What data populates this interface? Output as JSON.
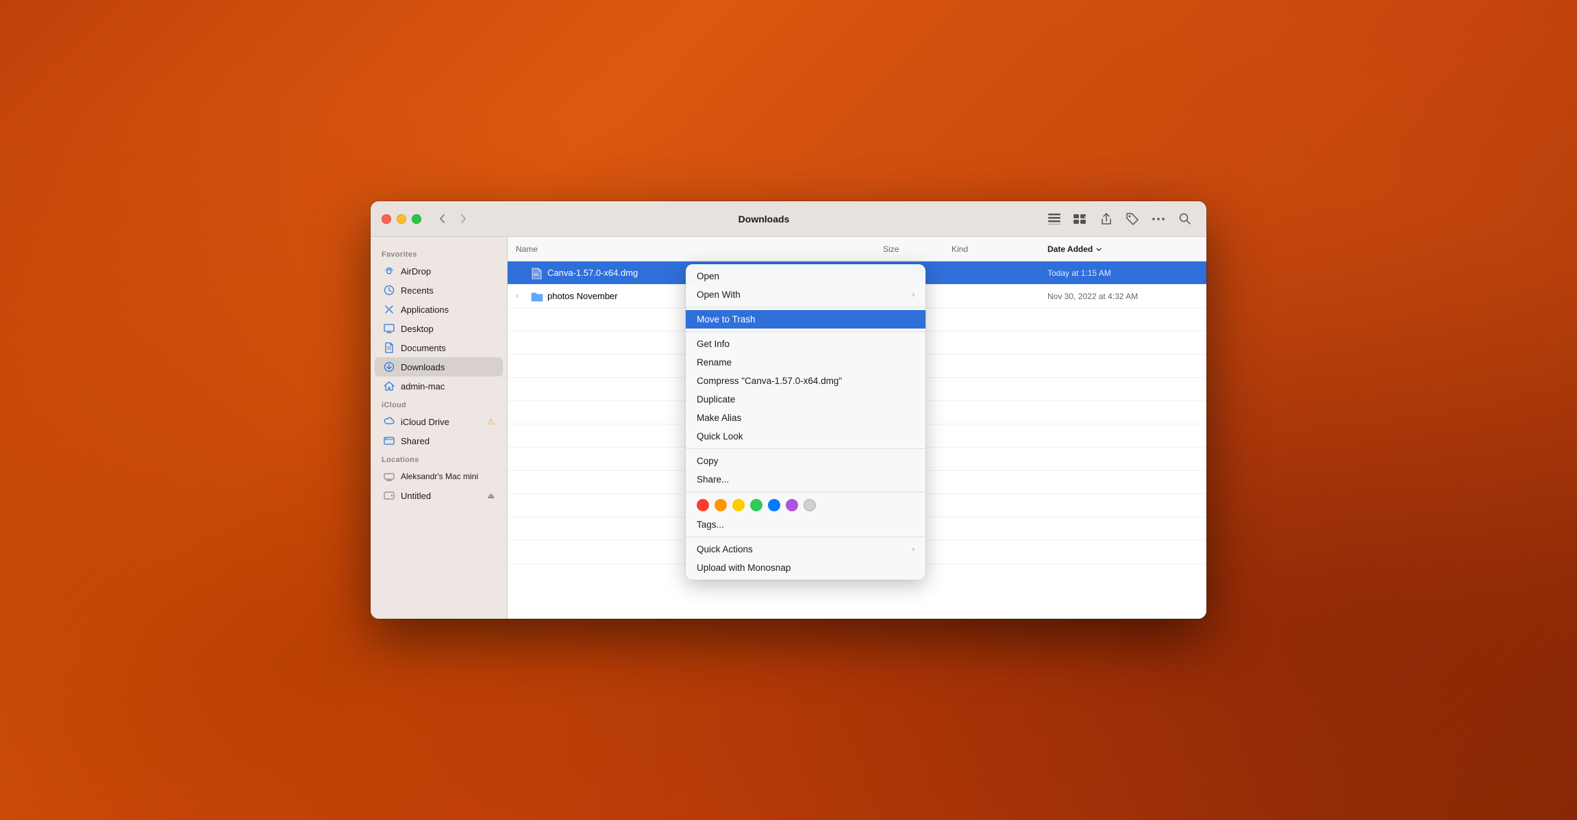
{
  "window": {
    "title": "Downloads"
  },
  "sidebar": {
    "sections": [
      {
        "label": "Favorites",
        "items": [
          {
            "id": "airdrop",
            "label": "AirDrop",
            "icon": "airdrop"
          },
          {
            "id": "recents",
            "label": "Recents",
            "icon": "recents"
          },
          {
            "id": "applications",
            "label": "Applications",
            "icon": "applications"
          },
          {
            "id": "desktop",
            "label": "Desktop",
            "icon": "desktop"
          },
          {
            "id": "documents",
            "label": "Documents",
            "icon": "documents"
          },
          {
            "id": "downloads",
            "label": "Downloads",
            "icon": "downloads",
            "active": true
          },
          {
            "id": "admin-mac",
            "label": "admin-mac",
            "icon": "home"
          }
        ]
      },
      {
        "label": "iCloud",
        "items": [
          {
            "id": "icloud-drive",
            "label": "iCloud Drive",
            "icon": "icloud",
            "warning": true
          },
          {
            "id": "shared",
            "label": "Shared",
            "icon": "shared"
          }
        ]
      },
      {
        "label": "Locations",
        "items": [
          {
            "id": "mac-mini",
            "label": "Aleksandr's Mac mini",
            "icon": "computer"
          },
          {
            "id": "untitled",
            "label": "Untitled",
            "icon": "drive",
            "eject": true
          }
        ]
      }
    ]
  },
  "columns": {
    "name": "Name",
    "size": "Size",
    "kind": "Kind",
    "date": "Date Added"
  },
  "files": [
    {
      "id": 1,
      "name": "Canva-1.57.0-x64.dmg",
      "size": "",
      "kind": "",
      "date": "Today at 1:15 AM",
      "selected": true,
      "type": "dmg",
      "expand": false
    },
    {
      "id": 2,
      "name": "photos November",
      "size": "",
      "kind": "",
      "date": "Nov 30, 2022 at 4:32 AM",
      "selected": false,
      "type": "folder",
      "expand": true
    }
  ],
  "context_menu": {
    "items": [
      {
        "id": "open",
        "label": "Open",
        "has_arrow": false,
        "separator_after": false
      },
      {
        "id": "open-with",
        "label": "Open With",
        "has_arrow": true,
        "separator_after": true
      },
      {
        "id": "move-to-trash",
        "label": "Move to Trash",
        "highlighted": true,
        "has_arrow": false,
        "separator_after": false
      },
      {
        "id": "get-info",
        "label": "Get Info",
        "has_arrow": false,
        "separator_after": false
      },
      {
        "id": "rename",
        "label": "Rename",
        "has_arrow": false,
        "separator_after": false
      },
      {
        "id": "compress",
        "label": "Compress \"Canva-1.57.0-x64.dmg\"",
        "has_arrow": false,
        "separator_after": false
      },
      {
        "id": "duplicate",
        "label": "Duplicate",
        "has_arrow": false,
        "separator_after": false
      },
      {
        "id": "make-alias",
        "label": "Make Alias",
        "has_arrow": false,
        "separator_after": false
      },
      {
        "id": "quick-look",
        "label": "Quick Look",
        "has_arrow": false,
        "separator_after": true
      },
      {
        "id": "copy",
        "label": "Copy",
        "has_arrow": false,
        "separator_after": false
      },
      {
        "id": "share",
        "label": "Share...",
        "has_arrow": false,
        "separator_after": true
      },
      {
        "id": "tags",
        "label": "Tags...",
        "has_arrow": false,
        "separator_after": true
      },
      {
        "id": "quick-actions",
        "label": "Quick Actions",
        "has_arrow": true,
        "separator_after": false
      },
      {
        "id": "upload-monosnap",
        "label": "Upload with Monosnap",
        "has_arrow": false,
        "separator_after": false
      }
    ],
    "tag_colors": [
      "#ff3b30",
      "#ff9500",
      "#ffcc00",
      "#34c759",
      "#007aff",
      "#af52de",
      "#d0d0d0"
    ]
  },
  "toolbar": {
    "back_label": "‹",
    "forward_label": "›",
    "list_view_icon": "list-view",
    "group_icon": "group",
    "share_icon": "share",
    "tag_icon": "tag",
    "more_icon": "more",
    "search_icon": "search"
  }
}
